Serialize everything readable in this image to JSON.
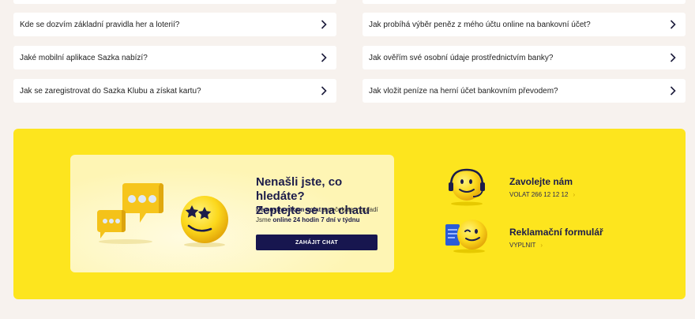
{
  "faq": {
    "left": [
      "Kde se dozvím základní pravidla her a loterií?",
      "Jaké mobilní aplikace Sazka nabízí?",
      "Jak se zaregistrovat do Sazka Klubu a získat kartu?"
    ],
    "right": [
      "Jak probíhá výběr peněz z mého účtu online na bankovní účet?",
      "Jak ověřím své osobní údaje prostřednictvím banky?",
      "Jak vložit peníze na herní účet bankovním převodem?"
    ]
  },
  "chat": {
    "title_line1": "Nenašli jste, co hledáte?",
    "title_line2": "Zeptejte se na chatu",
    "line1_bold": "Nemusíte nikam volat",
    "line1_rest": " a nečekáte v pořadí",
    "line2_start": "Jsme ",
    "line2_bold": "online 24 hodin 7 dní v týdnu",
    "button": "ZAHÁJIT CHAT"
  },
  "contacts": {
    "call_title": "Zavolejte nám",
    "call_link": "VOLAT 266 12 12 12",
    "form_title": "Reklamační formulář",
    "form_link": "VYPLNIT",
    "arrow": "›"
  },
  "colors": {
    "panel": "#fde51e",
    "button": "#17164f",
    "text_dark": "#1c1c4a"
  },
  "icons": [
    "chevron-right-icon",
    "chat-bubbles-icon",
    "star-eyes-emoji-icon",
    "headset-emoji-icon",
    "document-wink-emoji-icon"
  ]
}
